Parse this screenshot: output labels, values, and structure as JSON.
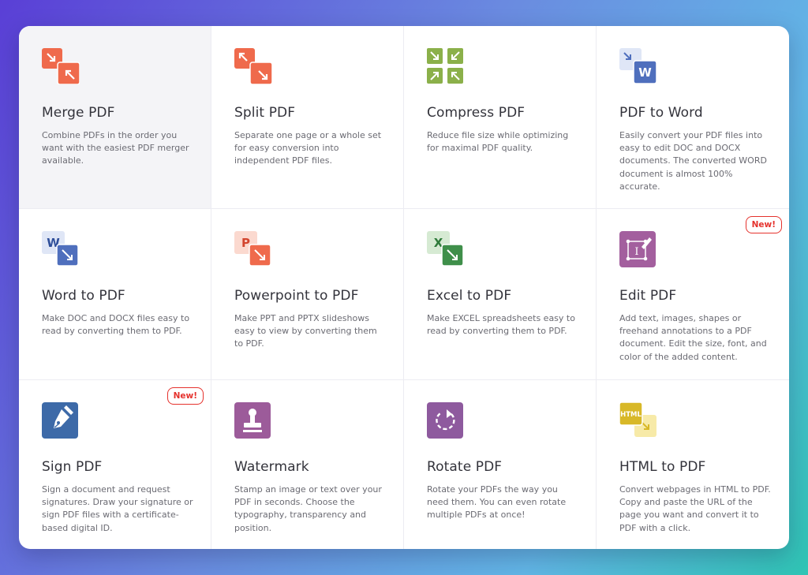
{
  "colors": {
    "red": "#ef6a4c",
    "green": "#8bb04a",
    "word_blue": "#4f6fbd",
    "ppt_red": "#e0533c",
    "excel_green": "#3f8f4a",
    "edit_purple": "#a35f9e",
    "sign_blue": "#3d6aa8",
    "watermark_purple": "#9c5b9a",
    "rotate_purple": "#8e5a9e",
    "html_yellow": "#d8b828",
    "badge_red": "#e5322d"
  },
  "tools": [
    {
      "title": "Merge PDF",
      "description": "Combine PDFs in the order you want with the easiest PDF merger available.",
      "icon": "merge-icon"
    },
    {
      "title": "Split PDF",
      "description": "Separate one page or a whole set for easy conversion into independent PDF files.",
      "icon": "split-icon"
    },
    {
      "title": "Compress PDF",
      "description": "Reduce file size while optimizing for maximal PDF quality.",
      "icon": "compress-icon"
    },
    {
      "title": "PDF to Word",
      "description": "Easily convert your PDF files into easy to edit DOC and DOCX documents. The converted WORD document is almost 100% accurate.",
      "icon": "pdf-to-word-icon"
    },
    {
      "title": "Word to PDF",
      "description": "Make DOC and DOCX files easy to read by converting them to PDF.",
      "icon": "word-to-pdf-icon"
    },
    {
      "title": "Powerpoint to PDF",
      "description": "Make PPT and PPTX slideshows easy to view by converting them to PDF.",
      "icon": "powerpoint-to-pdf-icon"
    },
    {
      "title": "Excel to PDF",
      "description": "Make EXCEL spreadsheets easy to read by converting them to PDF.",
      "icon": "excel-to-pdf-icon"
    },
    {
      "title": "Edit PDF",
      "description": "Add text, images, shapes or freehand annotations to a PDF document. Edit the size, font, and color of the added content.",
      "icon": "edit-pdf-icon",
      "badge": "New!"
    },
    {
      "title": "Sign PDF",
      "description": "Sign a document and request signatures. Draw your signature or sign PDF files with a certificate-based digital ID.",
      "icon": "sign-pdf-icon",
      "badge": "New!"
    },
    {
      "title": "Watermark",
      "description": "Stamp an image or text over your PDF in seconds. Choose the typography, transparency and position.",
      "icon": "watermark-icon"
    },
    {
      "title": "Rotate PDF",
      "description": "Rotate your PDFs the way you need them. You can even rotate multiple PDFs at once!",
      "icon": "rotate-icon"
    },
    {
      "title": "HTML to PDF",
      "description": "Convert webpages in HTML to PDF. Copy and paste the URL of the page you want and convert it to PDF with a click.",
      "icon": "html-to-pdf-icon"
    }
  ],
  "icon_text": {
    "word_letter": "W",
    "ppt_letter": "P",
    "excel_letter": "X",
    "edit_letter": "I",
    "html_label": "HTML"
  }
}
